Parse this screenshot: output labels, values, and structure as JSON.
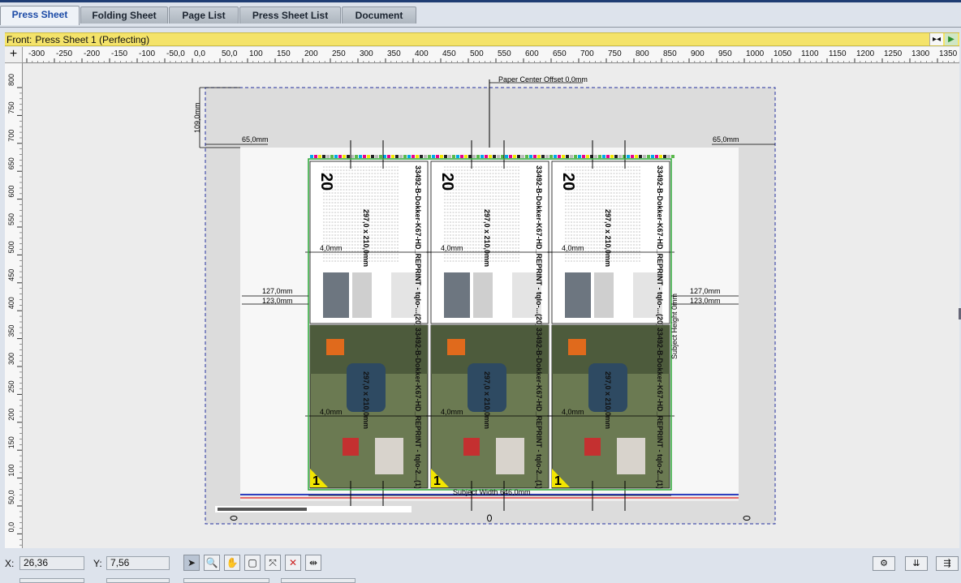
{
  "tabs": [
    "Press Sheet",
    "Folding Sheet",
    "Page List",
    "Press Sheet List",
    "Document"
  ],
  "front_bar": {
    "prefix": "Front:",
    "title": "Press Sheet 1 (Perfecting)"
  },
  "ruler_h": [
    "-300",
    "-250",
    "-200",
    "-150",
    "-100",
    "-50,0",
    "0,0",
    "50,0",
    "100",
    "150",
    "200",
    "250",
    "300",
    "350",
    "400",
    "450",
    "500",
    "550",
    "600",
    "650",
    "700",
    "750",
    "800",
    "850",
    "900",
    "950",
    "1000",
    "1050",
    "1100",
    "1150",
    "1200",
    "1250",
    "1300",
    "1350"
  ],
  "ruler_v": [
    "800",
    "750",
    "700",
    "650",
    "600",
    "550",
    "500",
    "450",
    "400",
    "350",
    "300",
    "250",
    "200",
    "150",
    "100",
    "50,0",
    "0,0"
  ],
  "dims": {
    "paper_center": "Paper Center Offset 0,0mm",
    "top_offset": "109,0mm",
    "left_65": "65,0mm",
    "right_65": "65,0mm",
    "left_127": "127,0mm",
    "left_123": "123,0mm",
    "right_127": "127,0mm",
    "right_123": "123,0mm",
    "gap": "4,0mm",
    "subject_width": "Subject Width 646,0mm",
    "subject_height": "Subject Height 0mm"
  },
  "pages": {
    "top_num": "20",
    "bottom_num": "1",
    "job_top": "33492-B-Dokker-K67-HD_REPRINT - tqlo-...(20)",
    "job_bottom": "33492-B-Dokker-K67-HD_REPRINT - tqlo-2...(1)",
    "size": "297,0 x 210,0mm"
  },
  "status": {
    "x_label": "X:",
    "x_value": "26,36",
    "y_label": "Y:",
    "y_value": "7,56"
  },
  "tool_icons": [
    "pointer-icon",
    "zoom-icon",
    "hand-icon",
    "crop-icon",
    "resize-icon",
    "delete-mark-icon",
    "measure-icon"
  ],
  "right_icons": [
    "settings-icon",
    "align-icon",
    "distribute-icon"
  ]
}
